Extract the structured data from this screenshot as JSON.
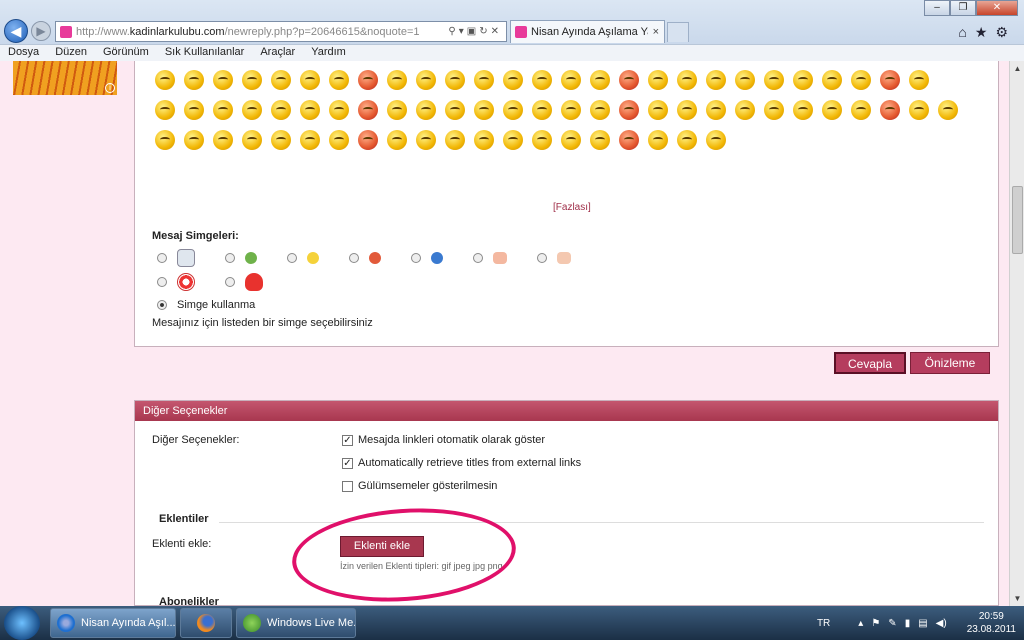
{
  "browser": {
    "url_prefix": "http://www.",
    "url_domain": "kadinlarkulubu.com",
    "url_rest": "/newreply.php?p=20646615&noquote=1",
    "tab_title": "Nisan Ayında Aşılama Yaptı...",
    "tab_close": "×",
    "menu": [
      "Dosya",
      "Düzen",
      "Görünüm",
      "Sık Kullanılanlar",
      "Araçlar",
      "Yardım"
    ]
  },
  "smilies": {
    "more_label": "[Fazlası]"
  },
  "message_icons": {
    "title": "Mesaj Simgeleri:",
    "none_label": "Simge kullanma",
    "hint": "Mesajınız için listeden bir simge seçebilirsiniz"
  },
  "actions": {
    "reply_label": "Cevapla",
    "preview_label": "Önizleme"
  },
  "other_options": {
    "header": "Diğer Seçenekler",
    "label": "Diğer Seçenekler:",
    "options": [
      {
        "label": "Mesajda linkleri otomatik olarak göster",
        "checked": true
      },
      {
        "label": "Automatically retrieve titles from external links",
        "checked": true
      },
      {
        "label": "Gülümsemeler gösterilmesin",
        "checked": false
      }
    ]
  },
  "attachments": {
    "header": "Eklentiler",
    "label": "Eklenti ekle:",
    "button_label": "Eklenti ekle",
    "allowed_types": "İzin verilen Eklenti tipleri: gif jpeg jpg png"
  },
  "subscriptions": {
    "header": "Abonelikler"
  },
  "taskbar": {
    "items": [
      "Nisan Ayında Aşıl...",
      "",
      "Windows Live Me..."
    ]
  },
  "tray": {
    "lang": "TR",
    "time": "20:59",
    "date": "23.08.2011"
  },
  "colors": {
    "accent": "#b53d5e",
    "annotation_circle": "#e0106a"
  }
}
